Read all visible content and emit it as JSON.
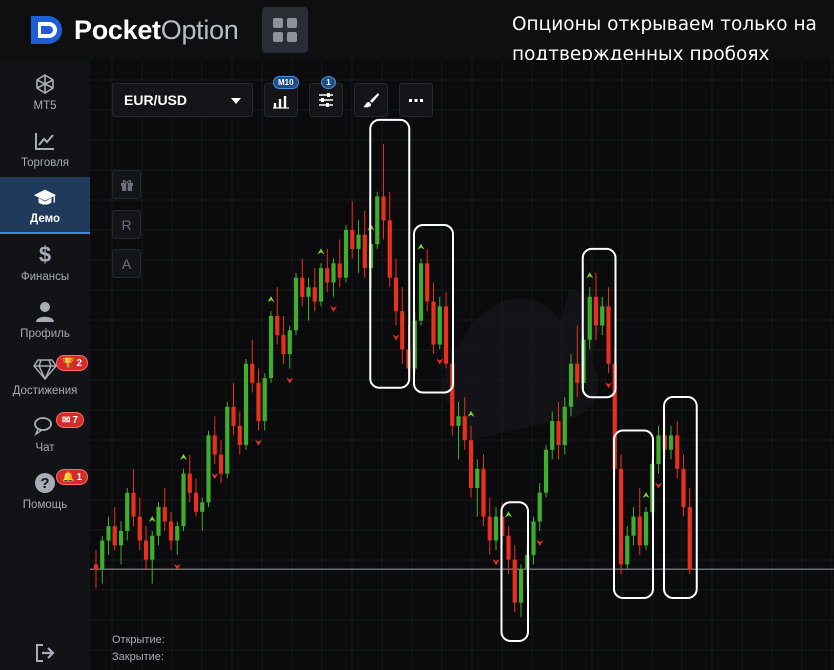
{
  "header": {
    "logo_bold": "Pocket",
    "logo_light": "Option",
    "annotation": "Опционы открываем только на подтвержденных пробоях фракталов: вверх для CALL, вниз для PUT."
  },
  "sidebar": {
    "items": [
      {
        "label": "MT5",
        "icon": "mt5-icon"
      },
      {
        "label": "Торговля",
        "icon": "chart-line-icon"
      },
      {
        "label": "Демо",
        "icon": "graduation-cap-icon",
        "active": true
      },
      {
        "label": "Финансы",
        "icon": "dollar-icon"
      },
      {
        "label": "Профиль",
        "icon": "user-icon"
      },
      {
        "label": "Достижения",
        "icon": "diamond-icon",
        "badge": "2"
      },
      {
        "label": "Чат",
        "icon": "chat-icon",
        "badge": "7"
      },
      {
        "label": "Помощь",
        "icon": "help-icon",
        "badge": "1"
      }
    ]
  },
  "toolbar": {
    "pair": "EUR/USD",
    "timeframe_badge": "M10",
    "indicators_count": "1",
    "left_tools": [
      "R",
      "A"
    ]
  },
  "trade_info": {
    "open_label": "Открытие:",
    "close_label": "Закрытие:"
  },
  "colors": {
    "accent": "#3b8de0",
    "bull": "#3fae2a",
    "bear": "#e8301c",
    "fractal_up": "#7fd13b",
    "fractal_down": "#e8301c"
  },
  "chart_data": {
    "type": "candlestick",
    "candles": [
      {
        "o": 0.02,
        "h": 0.05,
        "l": -0.03,
        "c": 0.01
      },
      {
        "o": 0.01,
        "h": 0.08,
        "l": -0.02,
        "c": 0.07
      },
      {
        "o": 0.07,
        "h": 0.12,
        "l": 0.04,
        "c": 0.1
      },
      {
        "o": 0.1,
        "h": 0.14,
        "l": 0.05,
        "c": 0.06
      },
      {
        "o": 0.06,
        "h": 0.11,
        "l": 0.02,
        "c": 0.09
      },
      {
        "o": 0.09,
        "h": 0.18,
        "l": 0.07,
        "c": 0.17
      },
      {
        "o": 0.17,
        "h": 0.22,
        "l": 0.1,
        "c": 0.12
      },
      {
        "o": 0.12,
        "h": 0.16,
        "l": 0.05,
        "c": 0.07
      },
      {
        "o": 0.07,
        "h": 0.1,
        "l": 0.01,
        "c": 0.03
      },
      {
        "o": 0.03,
        "h": 0.09,
        "l": -0.02,
        "c": 0.08
      },
      {
        "o": 0.08,
        "h": 0.15,
        "l": 0.06,
        "c": 0.14
      },
      {
        "o": 0.14,
        "h": 0.18,
        "l": 0.09,
        "c": 0.11
      },
      {
        "o": 0.11,
        "h": 0.13,
        "l": 0.05,
        "c": 0.07
      },
      {
        "o": 0.07,
        "h": 0.11,
        "l": 0.04,
        "c": 0.1
      },
      {
        "o": 0.1,
        "h": 0.22,
        "l": 0.09,
        "c": 0.21
      },
      {
        "o": 0.21,
        "h": 0.25,
        "l": 0.15,
        "c": 0.17
      },
      {
        "o": 0.17,
        "h": 0.2,
        "l": 0.12,
        "c": 0.13
      },
      {
        "o": 0.13,
        "h": 0.16,
        "l": 0.09,
        "c": 0.15
      },
      {
        "o": 0.15,
        "h": 0.3,
        "l": 0.14,
        "c": 0.29
      },
      {
        "o": 0.29,
        "h": 0.33,
        "l": 0.23,
        "c": 0.25
      },
      {
        "o": 0.25,
        "h": 0.28,
        "l": 0.19,
        "c": 0.21
      },
      {
        "o": 0.21,
        "h": 0.36,
        "l": 0.2,
        "c": 0.35
      },
      {
        "o": 0.35,
        "h": 0.4,
        "l": 0.29,
        "c": 0.31
      },
      {
        "o": 0.31,
        "h": 0.34,
        "l": 0.25,
        "c": 0.27
      },
      {
        "o": 0.27,
        "h": 0.45,
        "l": 0.26,
        "c": 0.44
      },
      {
        "o": 0.44,
        "h": 0.49,
        "l": 0.38,
        "c": 0.4
      },
      {
        "o": 0.4,
        "h": 0.43,
        "l": 0.3,
        "c": 0.32
      },
      {
        "o": 0.32,
        "h": 0.42,
        "l": 0.3,
        "c": 0.41
      },
      {
        "o": 0.41,
        "h": 0.55,
        "l": 0.4,
        "c": 0.54
      },
      {
        "o": 0.54,
        "h": 0.6,
        "l": 0.48,
        "c": 0.5
      },
      {
        "o": 0.5,
        "h": 0.54,
        "l": 0.44,
        "c": 0.46
      },
      {
        "o": 0.46,
        "h": 0.52,
        "l": 0.43,
        "c": 0.51
      },
      {
        "o": 0.51,
        "h": 0.63,
        "l": 0.5,
        "c": 0.62
      },
      {
        "o": 0.62,
        "h": 0.66,
        "l": 0.56,
        "c": 0.58
      },
      {
        "o": 0.58,
        "h": 0.62,
        "l": 0.53,
        "c": 0.6
      },
      {
        "o": 0.6,
        "h": 0.64,
        "l": 0.55,
        "c": 0.57
      },
      {
        "o": 0.57,
        "h": 0.65,
        "l": 0.56,
        "c": 0.64
      },
      {
        "o": 0.64,
        "h": 0.68,
        "l": 0.59,
        "c": 0.61
      },
      {
        "o": 0.61,
        "h": 0.66,
        "l": 0.58,
        "c": 0.65
      },
      {
        "o": 0.65,
        "h": 0.7,
        "l": 0.6,
        "c": 0.62
      },
      {
        "o": 0.62,
        "h": 0.73,
        "l": 0.61,
        "c": 0.72
      },
      {
        "o": 0.72,
        "h": 0.78,
        "l": 0.66,
        "c": 0.68
      },
      {
        "o": 0.68,
        "h": 0.74,
        "l": 0.63,
        "c": 0.71
      },
      {
        "o": 0.71,
        "h": 0.76,
        "l": 0.62,
        "c": 0.64
      },
      {
        "o": 0.64,
        "h": 0.7,
        "l": 0.6,
        "c": 0.69
      },
      {
        "o": 0.69,
        "h": 0.8,
        "l": 0.68,
        "c": 0.79
      },
      {
        "o": 0.79,
        "h": 0.9,
        "l": 0.7,
        "c": 0.74
      },
      {
        "o": 0.74,
        "h": 0.8,
        "l": 0.6,
        "c": 0.62
      },
      {
        "o": 0.62,
        "h": 0.66,
        "l": 0.52,
        "c": 0.55
      },
      {
        "o": 0.55,
        "h": 0.6,
        "l": 0.44,
        "c": 0.47
      },
      {
        "o": 0.47,
        "h": 0.52,
        "l": 0.4,
        "c": 0.43
      },
      {
        "o": 0.43,
        "h": 0.55,
        "l": 0.42,
        "c": 0.53
      },
      {
        "o": 0.53,
        "h": 0.66,
        "l": 0.52,
        "c": 0.65
      },
      {
        "o": 0.65,
        "h": 0.68,
        "l": 0.55,
        "c": 0.57
      },
      {
        "o": 0.57,
        "h": 0.61,
        "l": 0.46,
        "c": 0.48
      },
      {
        "o": 0.48,
        "h": 0.58,
        "l": 0.47,
        "c": 0.56
      },
      {
        "o": 0.56,
        "h": 0.59,
        "l": 0.43,
        "c": 0.44
      },
      {
        "o": 0.44,
        "h": 0.47,
        "l": 0.29,
        "c": 0.31
      },
      {
        "o": 0.31,
        "h": 0.36,
        "l": 0.24,
        "c": 0.33
      },
      {
        "o": 0.33,
        "h": 0.37,
        "l": 0.26,
        "c": 0.28
      },
      {
        "o": 0.28,
        "h": 0.31,
        "l": 0.16,
        "c": 0.18
      },
      {
        "o": 0.18,
        "h": 0.24,
        "l": 0.12,
        "c": 0.22
      },
      {
        "o": 0.22,
        "h": 0.25,
        "l": 0.1,
        "c": 0.12
      },
      {
        "o": 0.12,
        "h": 0.16,
        "l": 0.04,
        "c": 0.07
      },
      {
        "o": 0.07,
        "h": 0.14,
        "l": 0.05,
        "c": 0.12
      },
      {
        "o": 0.12,
        "h": 0.15,
        "l": 0.06,
        "c": 0.08
      },
      {
        "o": 0.08,
        "h": 0.1,
        "l": 0.0,
        "c": 0.03
      },
      {
        "o": 0.03,
        "h": 0.06,
        "l": -0.08,
        "c": -0.06
      },
      {
        "o": -0.06,
        "h": 0.02,
        "l": -0.09,
        "c": 0.01
      },
      {
        "o": 0.01,
        "h": 0.06,
        "l": -0.03,
        "c": 0.04
      },
      {
        "o": 0.04,
        "h": 0.12,
        "l": 0.02,
        "c": 0.11
      },
      {
        "o": 0.11,
        "h": 0.19,
        "l": 0.09,
        "c": 0.17
      },
      {
        "o": 0.17,
        "h": 0.27,
        "l": 0.16,
        "c": 0.26
      },
      {
        "o": 0.26,
        "h": 0.34,
        "l": 0.24,
        "c": 0.32
      },
      {
        "o": 0.32,
        "h": 0.36,
        "l": 0.24,
        "c": 0.27
      },
      {
        "o": 0.27,
        "h": 0.37,
        "l": 0.25,
        "c": 0.35
      },
      {
        "o": 0.35,
        "h": 0.46,
        "l": 0.33,
        "c": 0.44
      },
      {
        "o": 0.44,
        "h": 0.52,
        "l": 0.37,
        "c": 0.4
      },
      {
        "o": 0.4,
        "h": 0.5,
        "l": 0.38,
        "c": 0.49
      },
      {
        "o": 0.49,
        "h": 0.6,
        "l": 0.47,
        "c": 0.58
      },
      {
        "o": 0.58,
        "h": 0.63,
        "l": 0.49,
        "c": 0.52
      },
      {
        "o": 0.52,
        "h": 0.58,
        "l": 0.5,
        "c": 0.56
      },
      {
        "o": 0.56,
        "h": 0.6,
        "l": 0.42,
        "c": 0.44
      },
      {
        "o": 0.44,
        "h": 0.47,
        "l": 0.2,
        "c": 0.22
      },
      {
        "o": 0.22,
        "h": 0.25,
        "l": 0.0,
        "c": 0.02
      },
      {
        "o": 0.02,
        "h": 0.1,
        "l": 0.01,
        "c": 0.08
      },
      {
        "o": 0.08,
        "h": 0.14,
        "l": 0.06,
        "c": 0.12
      },
      {
        "o": 0.12,
        "h": 0.18,
        "l": 0.04,
        "c": 0.06
      },
      {
        "o": 0.06,
        "h": 0.14,
        "l": 0.05,
        "c": 0.13
      },
      {
        "o": 0.13,
        "h": 0.24,
        "l": 0.12,
        "c": 0.23
      },
      {
        "o": 0.23,
        "h": 0.31,
        "l": 0.21,
        "c": 0.29
      },
      {
        "o": 0.29,
        "h": 0.34,
        "l": 0.24,
        "c": 0.26
      },
      {
        "o": 0.26,
        "h": 0.31,
        "l": 0.24,
        "c": 0.29
      },
      {
        "o": 0.29,
        "h": 0.32,
        "l": 0.2,
        "c": 0.22
      },
      {
        "o": 0.22,
        "h": 0.25,
        "l": 0.12,
        "c": 0.14
      },
      {
        "o": 0.14,
        "h": 0.18,
        "l": 0.0,
        "c": 0.01
      }
    ],
    "fractals_up": [
      9,
      14,
      28,
      36,
      44,
      52,
      60,
      66,
      79,
      88
    ],
    "fractals_down": [
      13,
      19,
      26,
      31,
      38,
      48,
      55,
      64,
      71,
      82,
      90
    ],
    "highlight_ranges": [
      [
        45,
        49
      ],
      [
        52,
        56
      ],
      [
        66,
        68
      ],
      [
        79,
        82
      ],
      [
        84,
        88
      ],
      [
        92,
        95
      ]
    ],
    "current_price": 0.01,
    "ylim": [
      -0.18,
      0.95
    ]
  }
}
